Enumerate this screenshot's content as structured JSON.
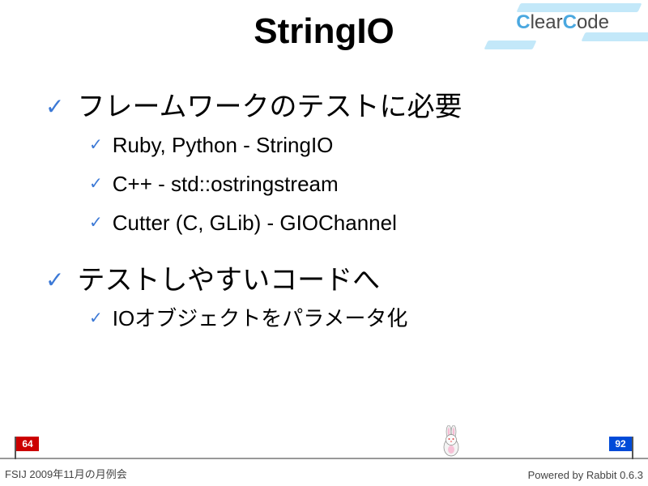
{
  "brand": {
    "c1": "C",
    "c2": "lear",
    "c3": "C",
    "c4": "ode"
  },
  "title": "StringIO",
  "bullets": [
    {
      "text": "フレームワークのテストに必要",
      "children": [
        "Ruby, Python - StringIO",
        "C++ - std::ostringstream",
        "Cutter (C, GLib) - GIOChannel"
      ]
    },
    {
      "text": "テストしやすいコードへ",
      "children": [
        "IOオブジェクトをパラメータ化"
      ]
    }
  ],
  "progress": {
    "current": "64",
    "total": "92"
  },
  "footer": {
    "left": "FSIJ 2009年11月の月例会",
    "right": "Powered by Rabbit 0.6.3"
  }
}
